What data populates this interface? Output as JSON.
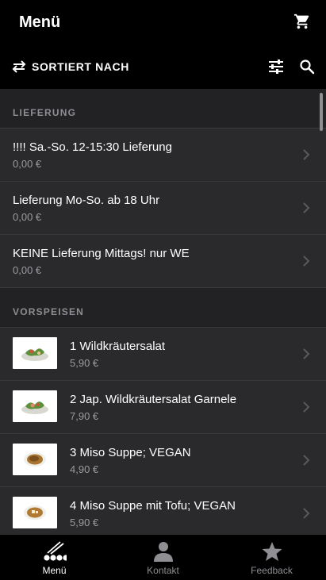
{
  "header": {
    "title": "Menü",
    "cart_icon": "shopping-cart-icon"
  },
  "sortbar": {
    "label": "SORTIERT NACH",
    "sort_icon": "swap-arrows-icon",
    "filter_icon": "sliders-icon",
    "search_icon": "search-icon"
  },
  "sections": [
    {
      "title": "LIEFERUNG",
      "items": [
        {
          "name": "!!!! Sa.-So. 12-15:30 Lieferung",
          "price": "0,00 €"
        },
        {
          "name": "Lieferung Mo-So. ab 18 Uhr",
          "price": "0,00 €"
        },
        {
          "name": "KEINE Lieferung Mittags! nur WE",
          "price": "0,00 €"
        }
      ]
    },
    {
      "title": "VORSPEISEN",
      "items": [
        {
          "name": "1 Wildkräutersalat",
          "price": "5,90 €",
          "image": "salad"
        },
        {
          "name": "2 Jap. Wildkräutersalat Garnele",
          "price": "7,90 €",
          "image": "salad"
        },
        {
          "name": "3 Miso Suppe; VEGAN",
          "price": "4,90 €",
          "image": "soup"
        },
        {
          "name": "4 Miso Suppe mit Tofu; VEGAN",
          "price": "5,90 €",
          "image": "soup"
        }
      ]
    }
  ],
  "tabs": [
    {
      "label": "Menü",
      "icon": "sushi-chopsticks-icon",
      "active": true
    },
    {
      "label": "Kontakt",
      "icon": "person-icon",
      "active": false
    },
    {
      "label": "Feedback",
      "icon": "star-icon",
      "active": false
    }
  ]
}
